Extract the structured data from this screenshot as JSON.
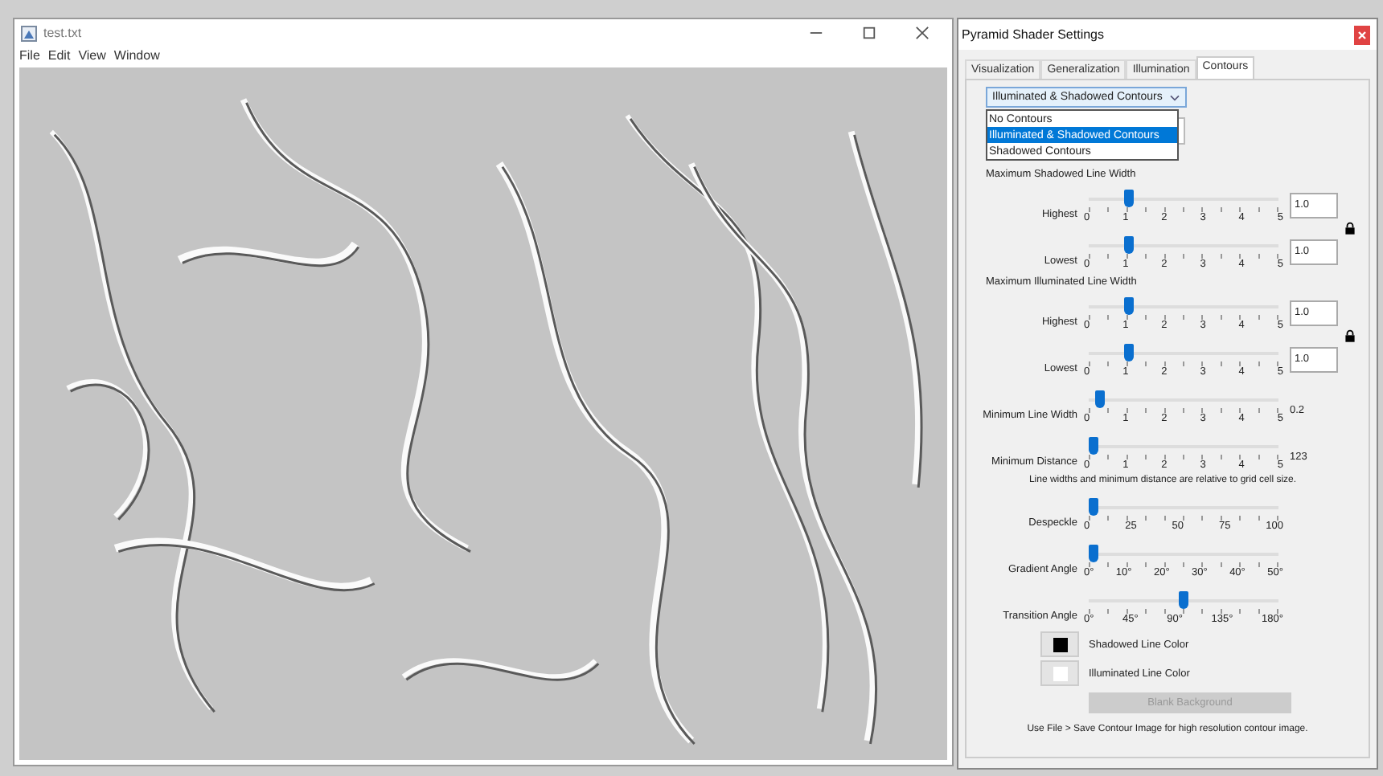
{
  "image_window": {
    "title": "test.txt",
    "menu": [
      "File",
      "Edit",
      "View",
      "Window"
    ],
    "picture": {
      "kind": "picture"
    }
  },
  "settings": {
    "title": "Pyramid Shader Settings",
    "tabs": [
      {
        "label": "Visualization",
        "selected": false
      },
      {
        "label": "Generalization",
        "selected": false
      },
      {
        "label": "Illumination",
        "selected": false
      },
      {
        "label": "Contours",
        "selected": true
      }
    ],
    "dropdown": {
      "value": "Illuminated & Shadowed Contours",
      "expanded": true,
      "options": [
        {
          "label": "No Contours",
          "selected": false
        },
        {
          "label": "Illuminated & Shadowed Contours",
          "selected": true
        },
        {
          "label": "Shadowed Contours",
          "selected": false
        }
      ]
    },
    "items": [
      {
        "kind": "pair",
        "heading": "Maximum Shadowed Line Width",
        "locked": true,
        "sliders": [
          {
            "label": "Highest",
            "level": 0.2,
            "ticks": [
              "0",
              "1",
              "2",
              "3",
              "4",
              "5"
            ],
            "field": "1.0"
          },
          {
            "label": "Lowest",
            "level": 0.2,
            "ticks": [
              "0",
              "1",
              "2",
              "3",
              "4",
              "5"
            ],
            "field": "1.0"
          }
        ]
      },
      {
        "kind": "pair",
        "heading": "Maximum Illuminated Line Width",
        "locked": true,
        "sliders": [
          {
            "label": "Highest",
            "level": 0.2,
            "ticks": [
              "0",
              "1",
              "2",
              "3",
              "4",
              "5"
            ],
            "field": "1.0"
          },
          {
            "label": "Lowest",
            "level": 0.2,
            "ticks": [
              "0",
              "1",
              "2",
              "3",
              "4",
              "5"
            ],
            "field": "1.0"
          }
        ]
      },
      {
        "kind": "slider",
        "label": "Minimum Line Width",
        "level": 0.04,
        "ticks": [
          "0",
          "1",
          "2",
          "3",
          "4",
          "5"
        ],
        "reading": "0.2"
      },
      {
        "kind": "slider",
        "label": "Minimum Distance",
        "level": 0,
        "ticks": [
          "0",
          "1",
          "2",
          "3",
          "4",
          "5"
        ],
        "reading": "123"
      },
      {
        "kind": "note",
        "text": "Line widths and minimum distance are relative to grid cell size."
      },
      {
        "kind": "slider",
        "label": "Despeckle",
        "level": 0,
        "ticks": [
          "0",
          "25",
          "50",
          "75",
          "100"
        ]
      },
      {
        "kind": "slider",
        "label": "Gradient Angle",
        "level": 0,
        "ticks": [
          "0°",
          "10°",
          "20°",
          "30°",
          "40°",
          "50°"
        ]
      },
      {
        "kind": "slider",
        "label": "Transition Angle",
        "level": 0.5,
        "ticks": [
          "0°",
          "45°",
          "90°",
          "135°",
          "180°"
        ]
      },
      {
        "kind": "color",
        "label": "Shadowed Line Color",
        "color": "#000000"
      },
      {
        "kind": "color",
        "label": "Illuminated Line Color",
        "color": "#ffffff"
      },
      {
        "kind": "button",
        "label": "Blank Background",
        "disabled": true
      },
      {
        "kind": "footer",
        "text": "Use File > Save Contour Image for high resolution contour image."
      }
    ]
  }
}
